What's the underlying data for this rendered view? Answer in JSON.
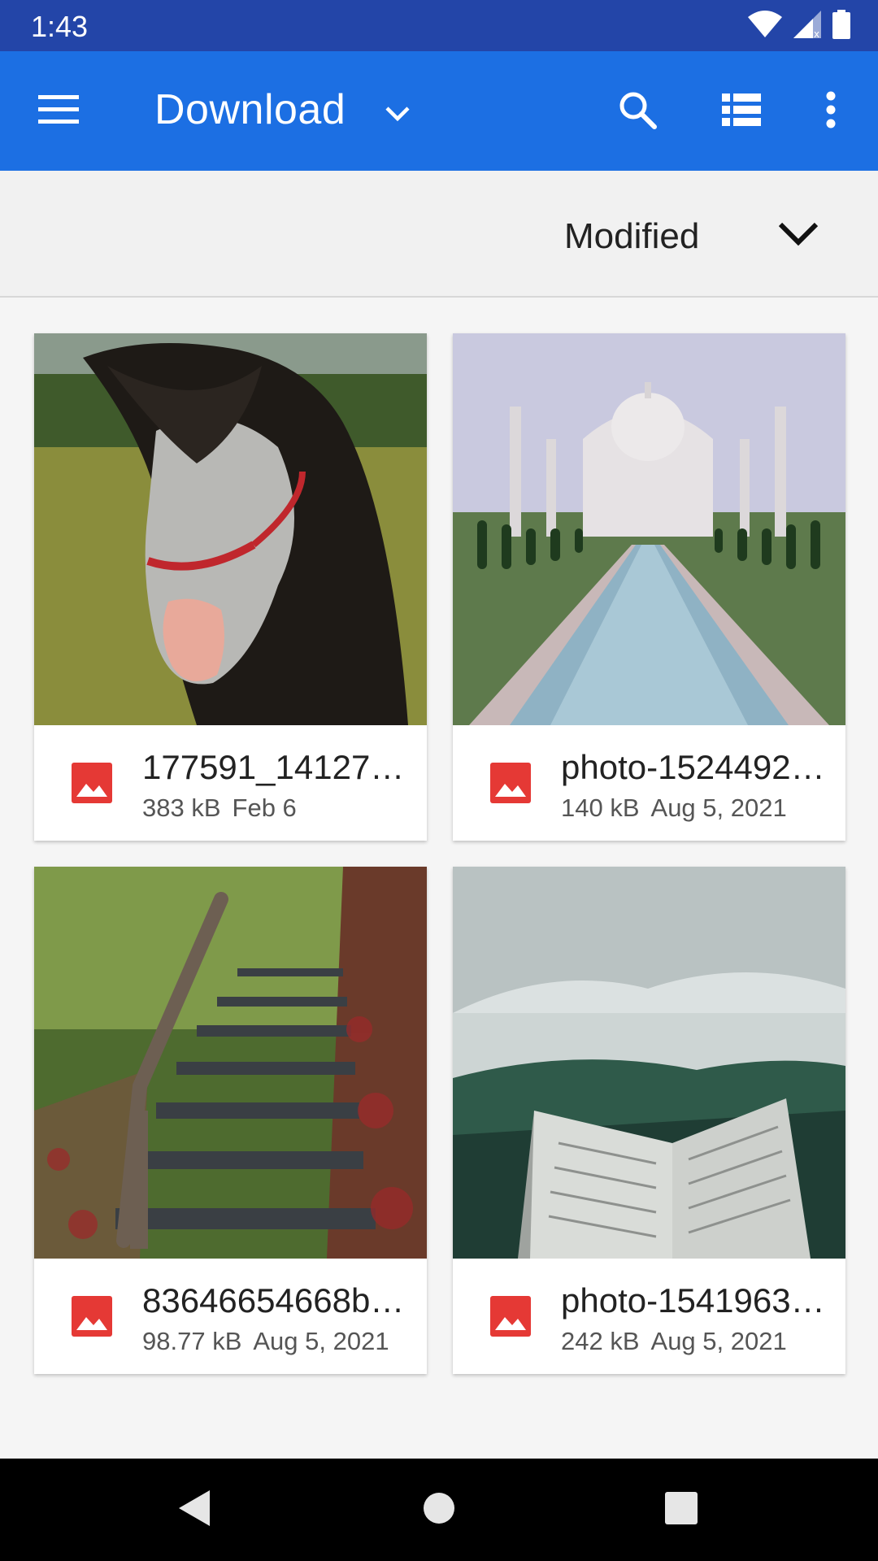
{
  "status_bar": {
    "time": "1:43",
    "icons": [
      "wifi-icon",
      "cellular-icon",
      "battery-icon"
    ]
  },
  "app_bar": {
    "title": "Download",
    "icons": [
      "menu-icon",
      "chevron-down-icon",
      "search-icon",
      "list-view-icon",
      "more-vert-icon"
    ]
  },
  "sort": {
    "label": "Modified",
    "icon": "chevron-down-icon"
  },
  "files": [
    {
      "name": "177591_14127…",
      "size": "383 kB",
      "date": "Feb 6",
      "thumbnail": "horse-photo",
      "type_icon": "image-file-icon"
    },
    {
      "name": "photo-1524492…",
      "size": "140 kB",
      "date": "Aug 5, 2021",
      "thumbnail": "taj-mahal-photo",
      "type_icon": "image-file-icon"
    },
    {
      "name": "83646654668b…",
      "size": "98.77 kB",
      "date": "Aug 5, 2021",
      "thumbnail": "forest-stairs-photo",
      "type_icon": "image-file-icon"
    },
    {
      "name": "photo-1541963…",
      "size": "242 kB",
      "date": "Aug 5, 2021",
      "thumbnail": "book-mountains-photo",
      "type_icon": "image-file-icon"
    }
  ],
  "colors": {
    "status_bar": "#2345a8",
    "app_bar": "#1c6fe3",
    "image_icon": "#e53935"
  },
  "nav_bar": {
    "icons": [
      "back-icon",
      "home-icon",
      "recents-icon"
    ]
  }
}
